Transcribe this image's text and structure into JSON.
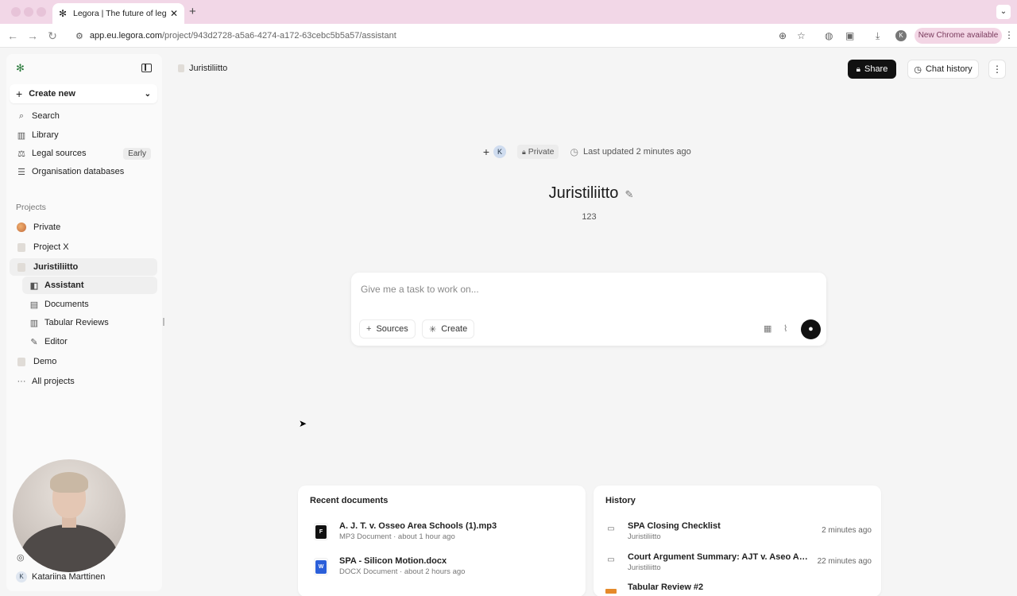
{
  "browser": {
    "tab_title": "Legora | The future of legal w",
    "tab_close": "✕",
    "new_tab": "+",
    "url_host": "app.eu.legora.com",
    "url_path": "/project/943d2728-a5a6-4274-a172-63cebc5b5a57/assistant",
    "profile_initial": "K",
    "update_label": "New Chrome available"
  },
  "sidebar": {
    "create_new": "Create new",
    "nav": [
      {
        "label": "Search",
        "icon": "search-icon"
      },
      {
        "label": "Library",
        "icon": "library-icon"
      },
      {
        "label": "Legal sources",
        "icon": "scales-icon",
        "badge": "Early"
      },
      {
        "label": "Organisation databases",
        "icon": "database-icon"
      }
    ],
    "projects_label": "Projects",
    "projects": [
      {
        "label": "Private"
      },
      {
        "label": "Project X"
      },
      {
        "label": "Juristiliitto",
        "active": true
      },
      {
        "label": "Demo"
      },
      {
        "label": "All projects"
      }
    ],
    "subitems": [
      {
        "label": "Assistant",
        "active": true
      },
      {
        "label": "Documents"
      },
      {
        "label": "Tabular Reviews"
      },
      {
        "label": "Editor"
      }
    ],
    "user_initial": "K",
    "user_name": "Katariina Marttinen"
  },
  "header": {
    "breadcrumb": "Juristiliitto",
    "share_label": "Share",
    "history_label": "Chat history"
  },
  "project": {
    "member_initial": "K",
    "visibility": "Private",
    "last_updated": "Last updated 2 minutes ago",
    "title": "Juristiliitto",
    "description": "123"
  },
  "composer": {
    "placeholder": "Give me a task to work on...",
    "sources_label": "Sources",
    "create_label": "Create"
  },
  "recent_documents": {
    "title": "Recent documents",
    "items": [
      {
        "name": "A. J. T. v. Osseo Area Schools (1).mp3",
        "meta": "MP3 Document · about 1 hour ago",
        "type_letter": "F"
      },
      {
        "name": "SPA - Silicon Motion.docx",
        "meta": "DOCX Document · about 2 hours ago",
        "type_letter": "W"
      }
    ]
  },
  "history": {
    "title": "History",
    "items": [
      {
        "name": "SPA Closing Checklist",
        "project": "Juristiliitto",
        "time": "2 minutes ago"
      },
      {
        "name": "Court Argument Summary: AJT v. Aseo Area...",
        "project": "Juristiliitto",
        "time": "22 minutes ago"
      },
      {
        "name": "Tabular Review #2",
        "project": "",
        "time": ""
      }
    ]
  }
}
